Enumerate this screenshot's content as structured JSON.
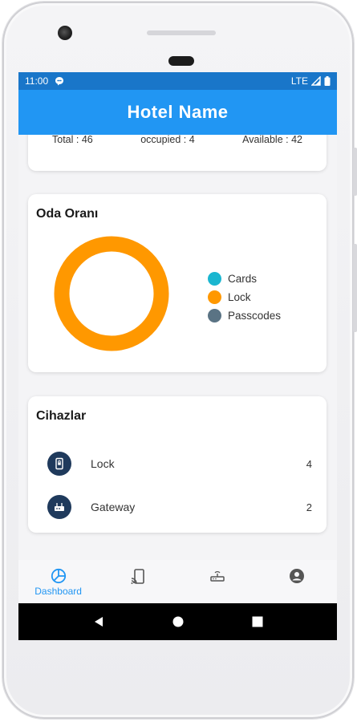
{
  "status_bar": {
    "time": "11:00",
    "network": "LTE"
  },
  "app_bar": {
    "title": "Hotel Name"
  },
  "summary": {
    "total": "Total : 46",
    "occupied": "occupied : 4",
    "available": "Available : 42"
  },
  "rooms_card": {
    "title": "Oda Oranı",
    "legend": [
      {
        "label": "Cards",
        "color": "#1ab6d0"
      },
      {
        "label": "Lock",
        "color": "#ff9800"
      },
      {
        "label": "Passcodes",
        "color": "#5a7384"
      }
    ],
    "donut": {
      "filled_series": "Lock",
      "ring_color": "#ff9800",
      "fraction": 1.0
    }
  },
  "devices_card": {
    "title": "Cihazlar",
    "items": [
      {
        "label": "Lock",
        "count": "4",
        "icon": "lock-device-icon"
      },
      {
        "label": "Gateway",
        "count": "2",
        "icon": "gateway-icon"
      }
    ]
  },
  "bottom_nav": {
    "items": [
      {
        "label": "Dashboard",
        "icon": "dashboard-icon",
        "active": true
      },
      {
        "label": "",
        "icon": "phone-cast-icon",
        "active": false
      },
      {
        "label": "",
        "icon": "router-icon",
        "active": false
      },
      {
        "label": "",
        "icon": "account-icon",
        "active": false
      }
    ],
    "active_color": "#2196f3",
    "inactive_color": "#555555"
  },
  "colors": {
    "status_bar": "#1976c9",
    "app_bar": "#2196f3",
    "device_icon_bg": "#1f3a5c"
  }
}
